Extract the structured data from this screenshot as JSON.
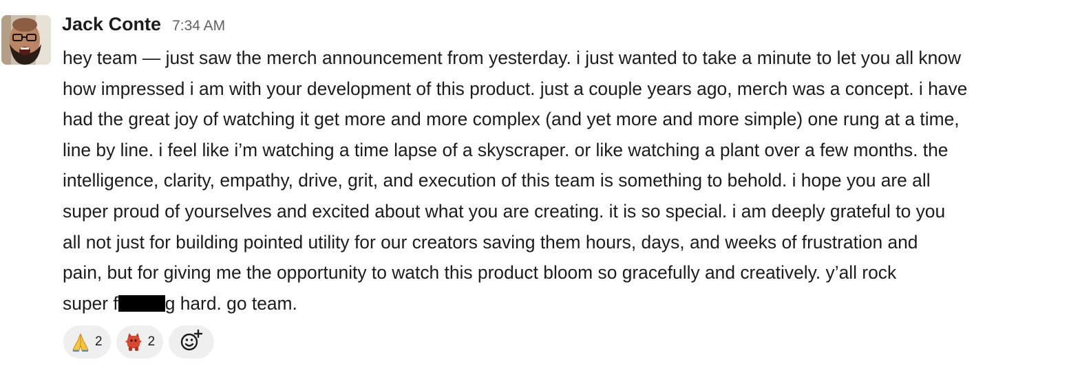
{
  "message": {
    "author": "Jack Conte",
    "timestamp": "7:34 AM",
    "lines": [
      "hey team — just saw the merch announcement from yesterday. i just wanted to take a minute to let you all know",
      "how impressed i am with your development of this product. just a couple years ago, merch was a concept. i have",
      "had the great joy of watching it get more and more complex (and yet more and more simple) one rung at a time,",
      "line by line. i feel like i’m watching a time lapse of a skyscraper. or like watching a plant over a few months. the",
      "intelligence, clarity, empathy, drive, grit, and execution of this team is something to behold. i hope you are all",
      "super proud of yourselves and excited about what you are creating. it is so special. i am deeply grateful to you",
      "all not just for building pointed utility for our creators saving them hours, days, and weeks of frustration and",
      "pain, but for giving me the opportunity to watch this product bloom so gracefully and creatively. y’all rock"
    ],
    "last_line_before": "super f",
    "last_line_after": "g hard. go team."
  },
  "reactions": [
    {
      "icon": "folded-hands-emoji",
      "count": "2"
    },
    {
      "icon": "red-monster-emoji",
      "count": "2"
    }
  ],
  "add_reaction_icon": "add-reaction-icon",
  "colors": {
    "text": "#1d1c1d",
    "timestamp": "#616061",
    "reaction_bg": "#efefef",
    "redaction": "#000000"
  }
}
